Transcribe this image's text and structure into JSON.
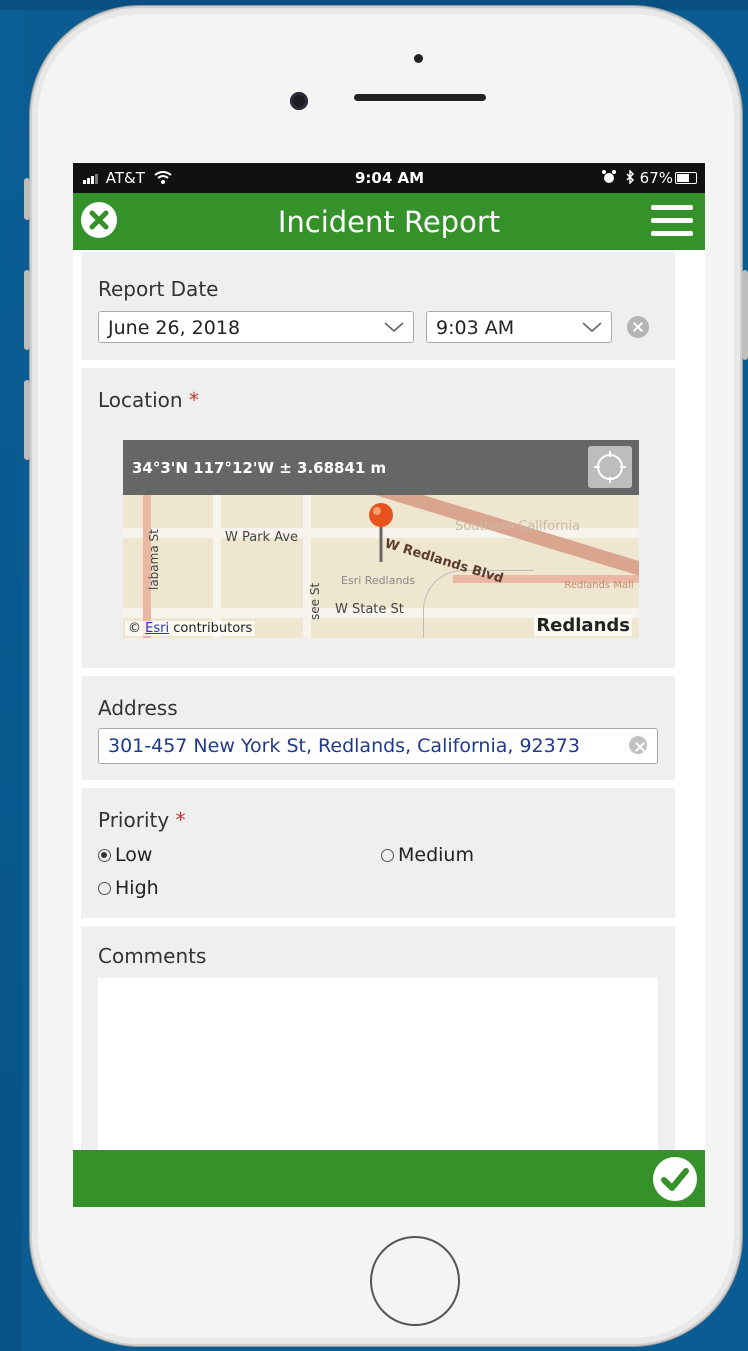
{
  "status_bar": {
    "carrier": "AT&T",
    "time": "9:04 AM",
    "battery": "67%"
  },
  "app_bar": {
    "title": "Incident Report",
    "close_icon": "close-icon",
    "menu_icon": "hamburger-menu-icon"
  },
  "report_date": {
    "label": "Report Date",
    "date_value": "June 26, 2018",
    "time_value": "9:03 AM"
  },
  "location": {
    "label": "Location",
    "required_mark": "*",
    "coordinates": "34°3'N 117°12'W ± 3.68841 m",
    "map_labels": {
      "w_park_ave": "W Park Ave",
      "w_redlands_blvd": "W Redlands Blvd",
      "southern_california": "Southern California",
      "esri_redlands": "Esri Redlands",
      "w_state_st": "W State St",
      "alabama_st": "labama St",
      "see_st": "see St",
      "redlands_mall": "Redlands Mall",
      "city": "Redlands"
    },
    "attribution_symbol": "©",
    "attribution_link": "Esri",
    "attribution_text": " contributors"
  },
  "address": {
    "label": "Address",
    "value": "301-457 New York St, Redlands, California, 92373"
  },
  "priority": {
    "label": "Priority",
    "required_mark": "*",
    "options": [
      "Low",
      "Medium",
      "High"
    ],
    "selected": "Low"
  },
  "comments": {
    "label": "Comments",
    "value": ""
  },
  "colors": {
    "brand_green": "#35922a",
    "background_blue": "#0a5c93"
  }
}
